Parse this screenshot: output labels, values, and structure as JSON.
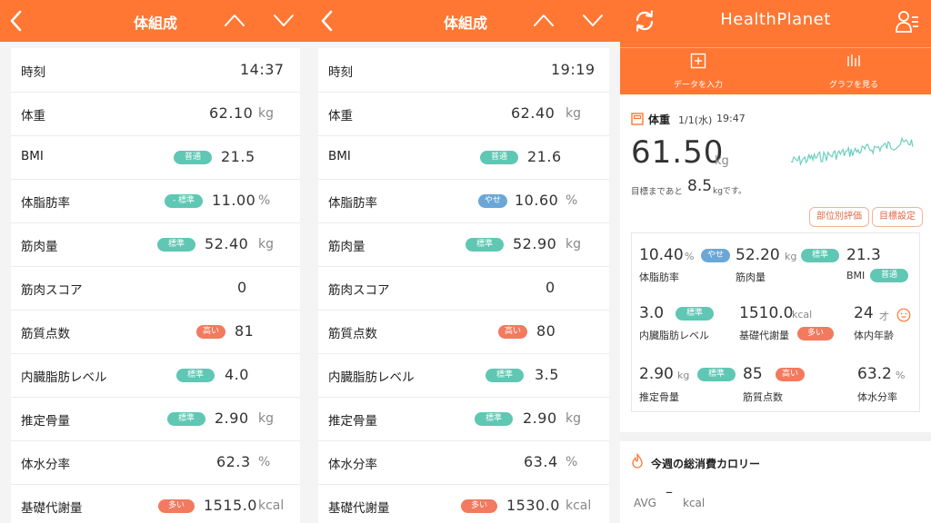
{
  "panels": [
    {
      "header": {
        "title": "体組成"
      },
      "rows": [
        {
          "label": "時刻",
          "value": "14:37",
          "unit": "",
          "badge": ""
        },
        {
          "label": "体重",
          "value": "62.10",
          "unit": "kg",
          "badge": ""
        },
        {
          "label": "BMI",
          "value": "21.5",
          "unit": "",
          "badge": "普通",
          "badge_color": "green"
        },
        {
          "label": "体脂肪率",
          "value": "11.00",
          "unit": "%",
          "badge": "- 標準",
          "badge_color": "green"
        },
        {
          "label": "筋肉量",
          "value": "52.40",
          "unit": "kg",
          "badge": "標準",
          "badge_color": "green"
        },
        {
          "label": "筋肉スコア",
          "value": "0",
          "unit": "",
          "badge": ""
        },
        {
          "label": "筋質点数",
          "value": "81",
          "unit": "",
          "badge": "高い",
          "badge_color": "red"
        },
        {
          "label": "内臓脂肪レベル",
          "value": "4.0",
          "unit": "",
          "badge": "標準",
          "badge_color": "green"
        },
        {
          "label": "推定骨量",
          "value": "2.90",
          "unit": "kg",
          "badge": "標準",
          "badge_color": "green"
        },
        {
          "label": "体水分率",
          "value": "62.3",
          "unit": "%",
          "badge": ""
        },
        {
          "label": "基礎代謝量",
          "value": "1515.0",
          "unit": "kcal",
          "badge": "多い",
          "badge_color": "red"
        }
      ]
    },
    {
      "header": {
        "title": "体組成"
      },
      "rows": [
        {
          "label": "時刻",
          "value": "19:19",
          "unit": "",
          "badge": ""
        },
        {
          "label": "体重",
          "value": "62.40",
          "unit": "kg",
          "badge": ""
        },
        {
          "label": "BMI",
          "value": "21.6",
          "unit": "",
          "badge": "普通",
          "badge_color": "green"
        },
        {
          "label": "体脂肪率",
          "value": "10.60",
          "unit": "%",
          "badge": "やせ",
          "badge_color": "blue"
        },
        {
          "label": "筋肉量",
          "value": "52.90",
          "unit": "kg",
          "badge": "標準",
          "badge_color": "green"
        },
        {
          "label": "筋肉スコア",
          "value": "0",
          "unit": "",
          "badge": ""
        },
        {
          "label": "筋質点数",
          "value": "80",
          "unit": "",
          "badge": "高い",
          "badge_color": "red"
        },
        {
          "label": "内臓脂肪レベル",
          "value": "3.5",
          "unit": "",
          "badge": "標準",
          "badge_color": "green"
        },
        {
          "label": "推定骨量",
          "value": "2.90",
          "unit": "kg",
          "badge": "標準",
          "badge_color": "green"
        },
        {
          "label": "体水分率",
          "value": "63.4",
          "unit": "%",
          "badge": ""
        },
        {
          "label": "基礎代謝量",
          "value": "1530.0",
          "unit": "kcal",
          "badge": "多い",
          "badge_color": "red"
        }
      ]
    }
  ],
  "health": {
    "app_title": "HealthPlanet",
    "actions": {
      "input": "データを入力",
      "graph": "グラフを見る"
    },
    "weight": {
      "label": "体重",
      "date": "1/1(水)",
      "time": "19:47",
      "value": "61.50",
      "unit": "kg",
      "goal_prefix": "目標まであと",
      "goal_value": "8.5",
      "goal_suffix": "kgです。"
    },
    "buttons": {
      "part_eval": "部位別評価",
      "goal_setting": "目標設定"
    },
    "metrics": {
      "body_fat": {
        "value": "10.40",
        "unit": "%",
        "badge": "やせ",
        "label": "体脂肪率"
      },
      "muscle": {
        "value": "52.20",
        "unit": "kg",
        "badge": "標準",
        "label": "筋肉量"
      },
      "bmi": {
        "value": "21.3",
        "badge": "普通",
        "label": "BMI"
      },
      "visceral": {
        "value": "3.0",
        "badge": "標準",
        "label": "内臓脂肪レベル"
      },
      "bmr": {
        "value": "1510.0",
        "unit": "kcal",
        "badge": "多い",
        "label": "基礎代謝量"
      },
      "body_age": {
        "value": "24",
        "unit": "才",
        "label": "体内年齢"
      },
      "bone": {
        "value": "2.90",
        "unit": "kg",
        "badge": "標準",
        "label": "推定骨量"
      },
      "muscle_quality": {
        "value": "85",
        "badge": "高い",
        "label": "筋質点数"
      },
      "water": {
        "value": "63.2",
        "unit": "%",
        "label": "体水分率"
      }
    },
    "calorie": {
      "title": "今週の総消費カロリー",
      "avg_label": "AVG",
      "avg_value": "–",
      "unit": "kcal"
    }
  },
  "colors": {
    "accent": "#ff7733",
    "badge_green": "#5fc7b3",
    "badge_red": "#f27a5e",
    "badge_blue": "#6aa7d6",
    "sparkline": "#6ccfc0"
  }
}
